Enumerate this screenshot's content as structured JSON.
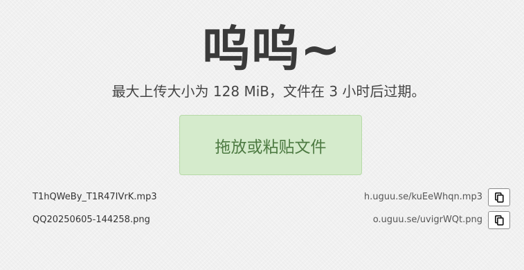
{
  "header": {
    "title": "呜呜~",
    "subtitle": "最大上传大小为 128 MiB，文件在 3 小时后过期。"
  },
  "dropzone": {
    "label": "拖放或粘贴文件"
  },
  "uploads": [
    {
      "file_name": "T1hQWeBy_T1R47IVrK.mp3",
      "url": "h.uguu.se/kuEeWhqn.mp3",
      "copy_icon": "copy-icon"
    },
    {
      "file_name": "QQ20250605-144258.png",
      "url": "o.uguu.se/uvigrWQt.png",
      "copy_icon": "copy-icon"
    }
  ],
  "colors": {
    "background": "#f1f1f1",
    "dropzone_bg": "#d5ebcc",
    "dropzone_text": "#4d7a42"
  }
}
